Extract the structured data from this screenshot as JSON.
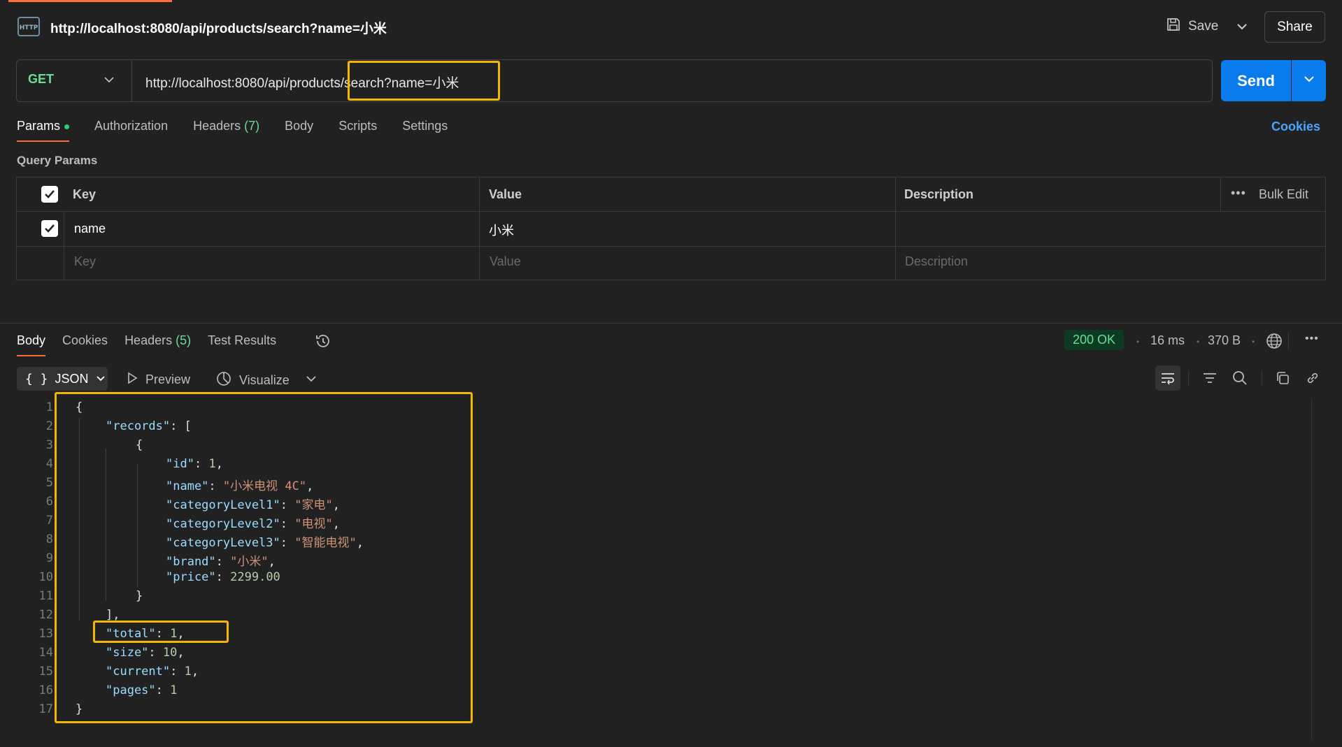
{
  "header": {
    "title": "http://localhost:8080/api/products/search?name=小米",
    "save_label": "Save",
    "share_label": "Share"
  },
  "request": {
    "method": "GET",
    "url": "http://localhost:8080/api/products/search?name=小米",
    "send_label": "Send"
  },
  "request_tabs": {
    "params": "Params",
    "authorization": "Authorization",
    "headers": "Headers",
    "headers_count": "(7)",
    "body": "Body",
    "scripts": "Scripts",
    "settings": "Settings",
    "cookies": "Cookies"
  },
  "query_params": {
    "label": "Query Params",
    "columns": {
      "key": "Key",
      "value": "Value",
      "description": "Description",
      "bulk_edit": "Bulk Edit"
    },
    "rows": [
      {
        "key": "name",
        "value": "小米",
        "checked": true
      }
    ],
    "placeholders": {
      "key": "Key",
      "value": "Value",
      "description": "Description"
    }
  },
  "response_tabs": {
    "body": "Body",
    "cookies": "Cookies",
    "headers": "Headers",
    "headers_count": "(5)",
    "test_results": "Test Results"
  },
  "response_meta": {
    "status": "200 OK",
    "time": "16 ms",
    "size": "370 B"
  },
  "response_toolbar": {
    "format": "JSON",
    "preview": "Preview",
    "visualize": "Visualize"
  },
  "code": {
    "line_numbers": [
      "1",
      "2",
      "3",
      "4",
      "5",
      "6",
      "7",
      "8",
      "9",
      "10",
      "11",
      "12",
      "13",
      "14",
      "15",
      "16",
      "17"
    ],
    "lines": [
      {
        "indent": 0,
        "tokens": [
          [
            "p",
            "{"
          ]
        ]
      },
      {
        "indent": 1,
        "tokens": [
          [
            "k",
            "\"records\""
          ],
          [
            "p",
            ": ["
          ]
        ]
      },
      {
        "indent": 2,
        "tokens": [
          [
            "p",
            "{"
          ]
        ]
      },
      {
        "indent": 3,
        "tokens": [
          [
            "k",
            "\"id\""
          ],
          [
            "p",
            ": "
          ],
          [
            "n",
            "1"
          ],
          [
            "p",
            ","
          ]
        ]
      },
      {
        "indent": 3,
        "tokens": [
          [
            "k",
            "\"name\""
          ],
          [
            "p",
            ": "
          ],
          [
            "s",
            "\"小米电视 4C\""
          ],
          [
            "p",
            ","
          ]
        ]
      },
      {
        "indent": 3,
        "tokens": [
          [
            "k",
            "\"categoryLevel1\""
          ],
          [
            "p",
            ": "
          ],
          [
            "s",
            "\"家电\""
          ],
          [
            "p",
            ","
          ]
        ]
      },
      {
        "indent": 3,
        "tokens": [
          [
            "k",
            "\"categoryLevel2\""
          ],
          [
            "p",
            ": "
          ],
          [
            "s",
            "\"电视\""
          ],
          [
            "p",
            ","
          ]
        ]
      },
      {
        "indent": 3,
        "tokens": [
          [
            "k",
            "\"categoryLevel3\""
          ],
          [
            "p",
            ": "
          ],
          [
            "s",
            "\"智能电视\""
          ],
          [
            "p",
            ","
          ]
        ]
      },
      {
        "indent": 3,
        "tokens": [
          [
            "k",
            "\"brand\""
          ],
          [
            "p",
            ": "
          ],
          [
            "s",
            "\"小米\""
          ],
          [
            "p",
            ","
          ]
        ]
      },
      {
        "indent": 3,
        "tokens": [
          [
            "k",
            "\"price\""
          ],
          [
            "p",
            ": "
          ],
          [
            "n",
            "2299.00"
          ]
        ]
      },
      {
        "indent": 2,
        "tokens": [
          [
            "p",
            "}"
          ]
        ]
      },
      {
        "indent": 1,
        "tokens": [
          [
            "p",
            "],"
          ]
        ]
      },
      {
        "indent": 1,
        "tokens": [
          [
            "k",
            "\"total\""
          ],
          [
            "p",
            ": "
          ],
          [
            "n",
            "1"
          ],
          [
            "p",
            ","
          ]
        ]
      },
      {
        "indent": 1,
        "tokens": [
          [
            "k",
            "\"size\""
          ],
          [
            "p",
            ": "
          ],
          [
            "n",
            "10"
          ],
          [
            "p",
            ","
          ]
        ]
      },
      {
        "indent": 1,
        "tokens": [
          [
            "k",
            "\"current\""
          ],
          [
            "p",
            ": "
          ],
          [
            "n",
            "1"
          ],
          [
            "p",
            ","
          ]
        ]
      },
      {
        "indent": 1,
        "tokens": [
          [
            "k",
            "\"pages\""
          ],
          [
            "p",
            ": "
          ],
          [
            "n",
            "1"
          ]
        ]
      },
      {
        "indent": 0,
        "tokens": [
          [
            "p",
            "}"
          ]
        ]
      }
    ]
  },
  "colors": {
    "accent": "#ff6c37",
    "send": "#097bed",
    "highlight": "#f4b400",
    "method_get": "#6bdd9a"
  }
}
